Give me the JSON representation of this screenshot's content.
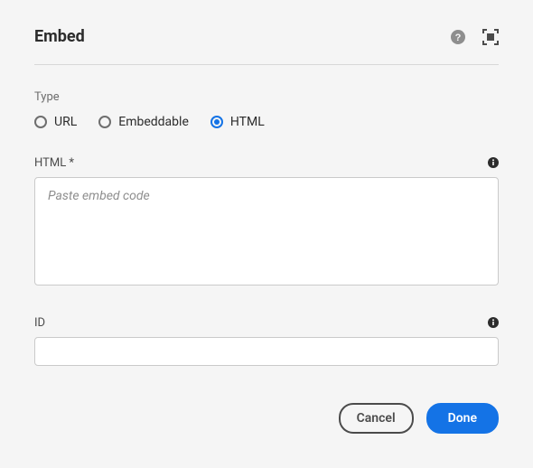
{
  "header": {
    "title": "Embed"
  },
  "type_section": {
    "label": "Type",
    "options": [
      {
        "label": "URL",
        "selected": false
      },
      {
        "label": "Embeddable",
        "selected": false
      },
      {
        "label": "HTML",
        "selected": true
      }
    ]
  },
  "html_field": {
    "label": "HTML *",
    "placeholder": "Paste embed code",
    "value": ""
  },
  "id_field": {
    "label": "ID",
    "value": ""
  },
  "footer": {
    "cancel_label": "Cancel",
    "done_label": "Done"
  }
}
